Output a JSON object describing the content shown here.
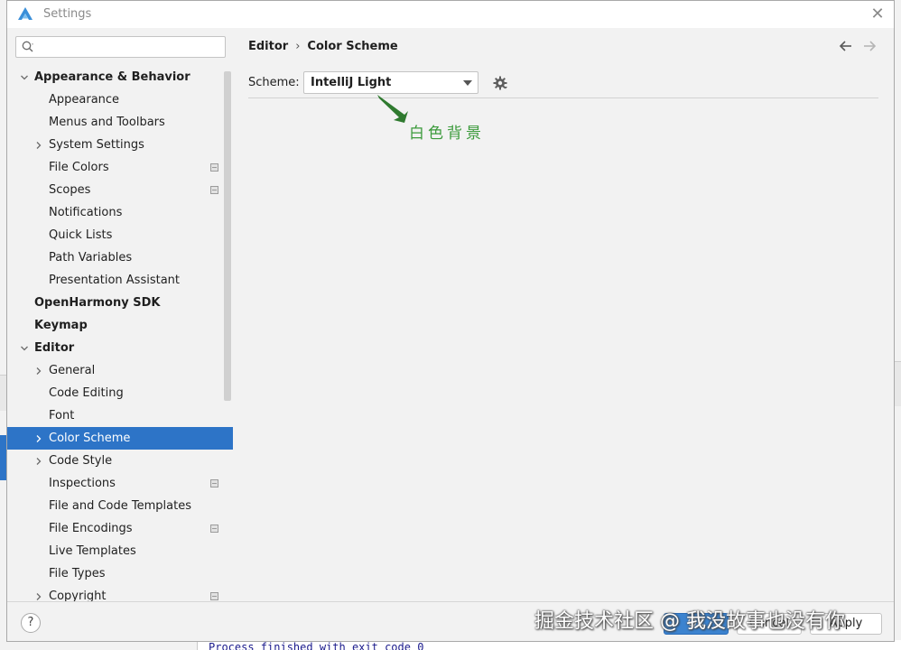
{
  "window": {
    "title": "Settings",
    "close_symbol": "✕",
    "logo_icon": "app-logo-icon"
  },
  "sidebar": {
    "search": {
      "value": "",
      "placeholder": ""
    },
    "items": [
      {
        "label": "Appearance & Behavior",
        "level": 0,
        "bold": true,
        "expanded": true,
        "has_arrow": true,
        "project_icon": false,
        "selected": false
      },
      {
        "label": "Appearance",
        "level": 1,
        "bold": false,
        "expanded": false,
        "has_arrow": false,
        "project_icon": false,
        "selected": false
      },
      {
        "label": "Menus and Toolbars",
        "level": 1,
        "bold": false,
        "expanded": false,
        "has_arrow": false,
        "project_icon": false,
        "selected": false
      },
      {
        "label": "System Settings",
        "level": 1,
        "bold": false,
        "expanded": false,
        "has_arrow": true,
        "project_icon": false,
        "selected": false
      },
      {
        "label": "File Colors",
        "level": 1,
        "bold": false,
        "expanded": false,
        "has_arrow": false,
        "project_icon": true,
        "selected": false
      },
      {
        "label": "Scopes",
        "level": 1,
        "bold": false,
        "expanded": false,
        "has_arrow": false,
        "project_icon": true,
        "selected": false
      },
      {
        "label": "Notifications",
        "level": 1,
        "bold": false,
        "expanded": false,
        "has_arrow": false,
        "project_icon": false,
        "selected": false
      },
      {
        "label": "Quick Lists",
        "level": 1,
        "bold": false,
        "expanded": false,
        "has_arrow": false,
        "project_icon": false,
        "selected": false
      },
      {
        "label": "Path Variables",
        "level": 1,
        "bold": false,
        "expanded": false,
        "has_arrow": false,
        "project_icon": false,
        "selected": false
      },
      {
        "label": "Presentation Assistant",
        "level": 1,
        "bold": false,
        "expanded": false,
        "has_arrow": false,
        "project_icon": false,
        "selected": false
      },
      {
        "label": "OpenHarmony SDK",
        "level": 0,
        "bold": true,
        "expanded": false,
        "has_arrow": false,
        "project_icon": false,
        "selected": false
      },
      {
        "label": "Keymap",
        "level": 0,
        "bold": true,
        "expanded": false,
        "has_arrow": false,
        "project_icon": false,
        "selected": false
      },
      {
        "label": "Editor",
        "level": 0,
        "bold": true,
        "expanded": true,
        "has_arrow": true,
        "project_icon": false,
        "selected": false
      },
      {
        "label": "General",
        "level": 1,
        "bold": false,
        "expanded": false,
        "has_arrow": true,
        "project_icon": false,
        "selected": false
      },
      {
        "label": "Code Editing",
        "level": 1,
        "bold": false,
        "expanded": false,
        "has_arrow": false,
        "project_icon": false,
        "selected": false
      },
      {
        "label": "Font",
        "level": 1,
        "bold": false,
        "expanded": false,
        "has_arrow": false,
        "project_icon": false,
        "selected": false
      },
      {
        "label": "Color Scheme",
        "level": 1,
        "bold": false,
        "expanded": false,
        "has_arrow": true,
        "project_icon": false,
        "selected": true
      },
      {
        "label": "Code Style",
        "level": 1,
        "bold": false,
        "expanded": false,
        "has_arrow": true,
        "project_icon": false,
        "selected": false
      },
      {
        "label": "Inspections",
        "level": 1,
        "bold": false,
        "expanded": false,
        "has_arrow": false,
        "project_icon": true,
        "selected": false
      },
      {
        "label": "File and Code Templates",
        "level": 1,
        "bold": false,
        "expanded": false,
        "has_arrow": false,
        "project_icon": false,
        "selected": false
      },
      {
        "label": "File Encodings",
        "level": 1,
        "bold": false,
        "expanded": false,
        "has_arrow": false,
        "project_icon": true,
        "selected": false
      },
      {
        "label": "Live Templates",
        "level": 1,
        "bold": false,
        "expanded": false,
        "has_arrow": false,
        "project_icon": false,
        "selected": false
      },
      {
        "label": "File Types",
        "level": 1,
        "bold": false,
        "expanded": false,
        "has_arrow": false,
        "project_icon": false,
        "selected": false
      },
      {
        "label": "Copyright",
        "level": 1,
        "bold": false,
        "expanded": false,
        "has_arrow": true,
        "project_icon": true,
        "selected": false
      }
    ]
  },
  "main": {
    "breadcrumb": [
      "Editor",
      "Color Scheme"
    ],
    "breadcrumb_separator": "›",
    "scheme_label": "Scheme:",
    "scheme_value": "IntelliJ Light",
    "annotation": "白色背景"
  },
  "footer": {
    "help_label": "?",
    "ok_label": "OK",
    "cancel_label": "Cancel",
    "apply_label": "Apply"
  },
  "background": {
    "console_text": "Process finished with exit code 0"
  },
  "watermark": "掘金技术社区 @ 我没故事也没有你",
  "colors": {
    "accent": "#2d74c7",
    "panel_bg": "#f2f2f2",
    "annotation": "#3b9a3b"
  }
}
